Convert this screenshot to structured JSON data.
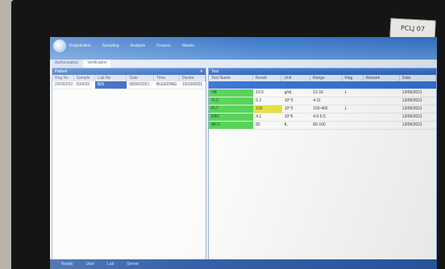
{
  "sticker": {
    "text": "PCLJ 07"
  },
  "app": {
    "menu": [
      "Registration",
      "Sampling",
      "Analysis",
      "Finance",
      "Master"
    ],
    "tabs": [
      "Authorisation",
      "Verification"
    ]
  },
  "left_panel": {
    "title": "Patient",
    "columns": [
      "Reg No",
      "Sample",
      "Lab No",
      "Date",
      "Time",
      "Doctor"
    ],
    "rows": [
      [
        "23/09/2021",
        "000039",
        "NIS",
        "08/09/2021",
        "BLEEDING",
        "10/10/2021"
      ]
    ]
  },
  "right_panel": {
    "title": "Test",
    "columns": [
      "Test Name",
      "Result",
      "Unit",
      "Range",
      "Flag",
      "Remark",
      "Date"
    ],
    "rows": [
      [
        "HB",
        "10.5",
        "g/dL",
        "12-16",
        "L",
        "",
        "13/09/2021"
      ],
      [
        "TLC",
        "6.2",
        "10^3",
        "4-11",
        "",
        "",
        "13/09/2021"
      ],
      [
        "PLT",
        "120",
        "10^3",
        "150-400",
        "L",
        "",
        "13/09/2021"
      ],
      [
        "RBC",
        "4.1",
        "10^6",
        "4.0-5.5",
        "",
        "",
        "13/09/2021"
      ],
      [
        "MCV",
        "82",
        "fL",
        "80-100",
        "",
        "",
        "13/09/2021"
      ]
    ]
  },
  "status": [
    "Ready",
    "User",
    "Lab",
    "Server"
  ]
}
